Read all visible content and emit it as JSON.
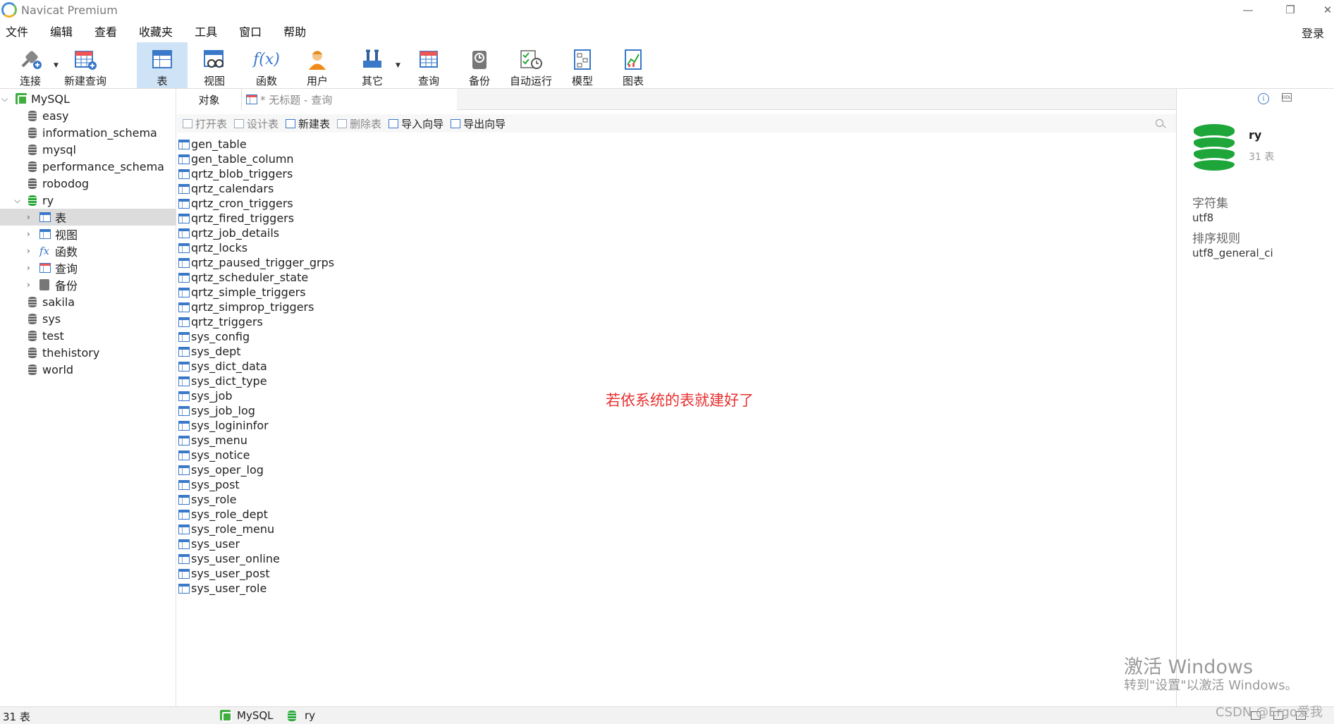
{
  "app": {
    "title": "Navicat Premium",
    "login": "登录"
  },
  "menu": [
    "文件",
    "编辑",
    "查看",
    "收藏夹",
    "工具",
    "窗口",
    "帮助"
  ],
  "toolbar": [
    {
      "label": "连接",
      "icon": "connection-icon"
    },
    {
      "label": "新建查询",
      "icon": "new-query-icon"
    },
    {
      "label": "表",
      "icon": "table-icon"
    },
    {
      "label": "视图",
      "icon": "view-icon"
    },
    {
      "label": "函数",
      "icon": "function-icon"
    },
    {
      "label": "用户",
      "icon": "user-icon"
    },
    {
      "label": "其它",
      "icon": "tools-icon"
    },
    {
      "label": "查询",
      "icon": "query-icon"
    },
    {
      "label": "备份",
      "icon": "backup-icon"
    },
    {
      "label": "自动运行",
      "icon": "schedule-icon"
    },
    {
      "label": "模型",
      "icon": "model-icon"
    },
    {
      "label": "图表",
      "icon": "chart-icon"
    }
  ],
  "sidebar": {
    "connection": "MySQL",
    "databases_before": [
      "easy",
      "information_schema",
      "mysql",
      "performance_schema",
      "robodog"
    ],
    "open_db": "ry",
    "ry_children": [
      "表",
      "视图",
      "函数",
      "查询",
      "备份"
    ],
    "databases_after": [
      "sakila",
      "sys",
      "test",
      "thehistory",
      "world"
    ],
    "fx_glyph": "fx"
  },
  "tabs": {
    "objects": "对象",
    "query": "* 无标题 - 查询"
  },
  "subtoolbar": [
    "打开表",
    "设计表",
    "新建表",
    "删除表",
    "导入向导",
    "导出向导"
  ],
  "tables": [
    "gen_table",
    "gen_table_column",
    "qrtz_blob_triggers",
    "qrtz_calendars",
    "qrtz_cron_triggers",
    "qrtz_fired_triggers",
    "qrtz_job_details",
    "qrtz_locks",
    "qrtz_paused_trigger_grps",
    "qrtz_scheduler_state",
    "qrtz_simple_triggers",
    "qrtz_simprop_triggers",
    "qrtz_triggers",
    "sys_config",
    "sys_dept",
    "sys_dict_data",
    "sys_dict_type",
    "sys_job",
    "sys_job_log",
    "sys_logininfor",
    "sys_menu",
    "sys_notice",
    "sys_oper_log",
    "sys_post",
    "sys_role",
    "sys_role_dept",
    "sys_role_menu",
    "sys_user",
    "sys_user_online",
    "sys_user_post",
    "sys_user_role"
  ],
  "annotation": "若依系统的表就建好了",
  "info": {
    "name": "ry",
    "count": "31 表",
    "charset_label": "字符集",
    "charset": "utf8",
    "collation_label": "排序规则",
    "collation": "utf8_general_ci",
    "info_glyph": "i",
    "ddl_glyph": "DDL"
  },
  "status": {
    "count": "31 表",
    "connection": "MySQL",
    "database": "ry"
  },
  "watermark": {
    "line1": "激活 Windows",
    "line2": "转到\"设置\"以激活 Windows。",
    "csdn": "CSDN @Ergo爱我"
  },
  "colors": {
    "accent": "#3a78c8",
    "db_green": "#1ea63a",
    "annotation": "#e83030",
    "active_tool": "#cfe3f6"
  }
}
